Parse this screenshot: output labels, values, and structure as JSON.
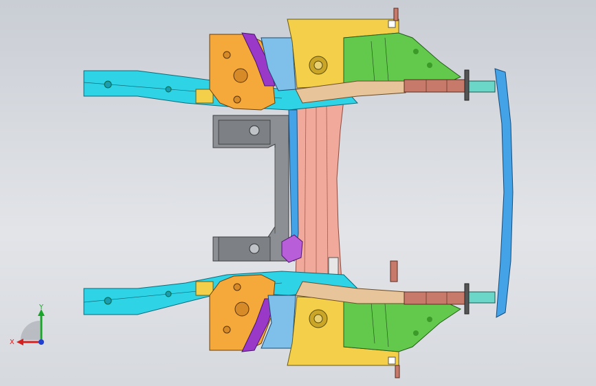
{
  "triad": {
    "x_label": "X",
    "y_label": "Y"
  },
  "colors": {
    "cyan": "#2fd3e6",
    "blue": "#43a3e6",
    "orange": "#f5a93a",
    "yellow": "#f4d04a",
    "salmon": "#f0a99a",
    "green": "#62c94c",
    "purple": "#9a38c8",
    "gray": "#8c8f93",
    "rust": "#c77a6a",
    "tan": "#e8c49a",
    "light_blue": "#7ec0ea"
  }
}
